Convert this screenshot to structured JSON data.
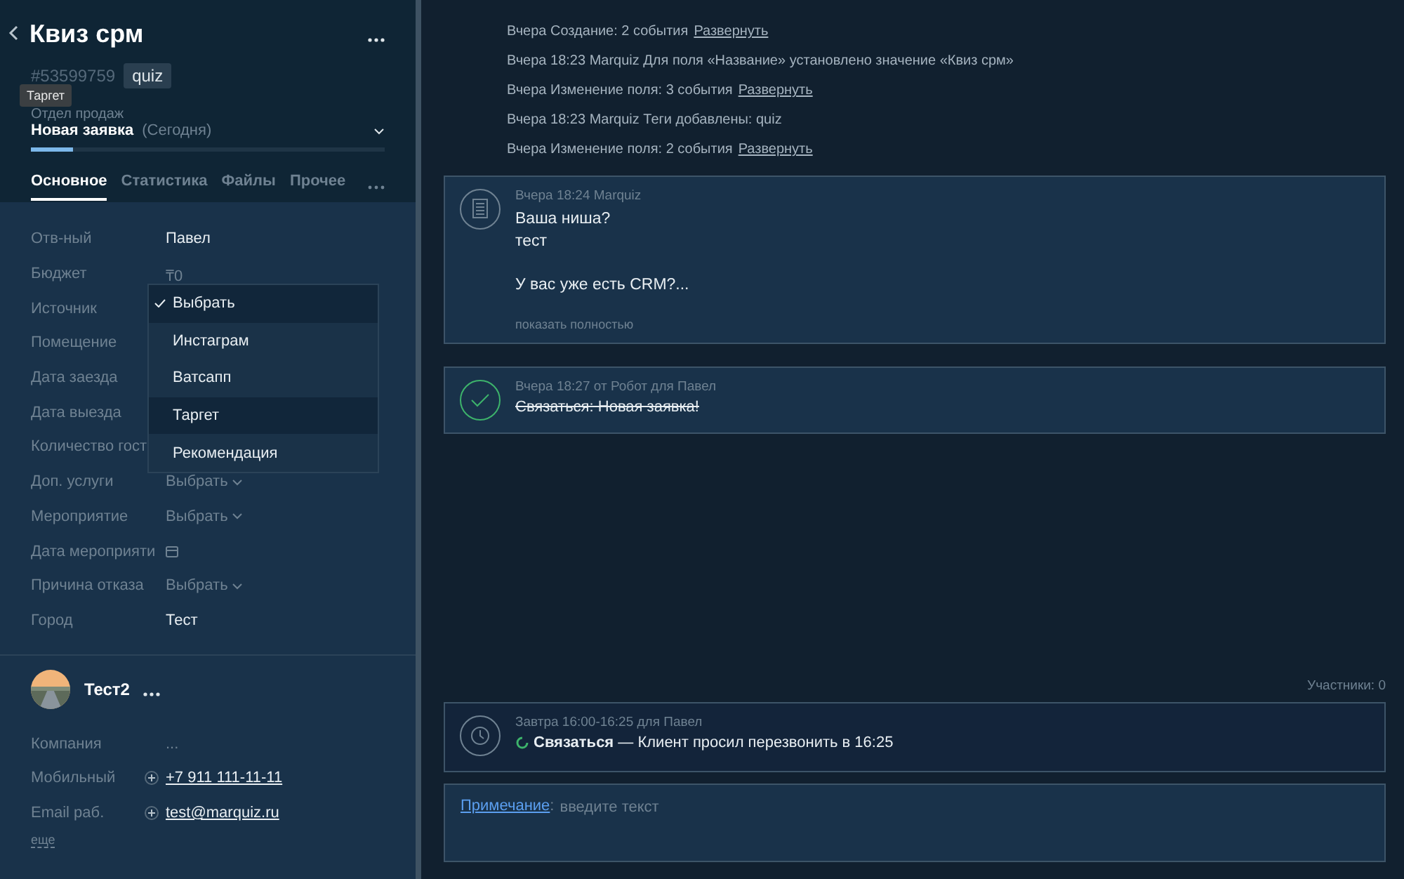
{
  "lead": {
    "title": "Квиз срм",
    "id": "#53599759",
    "tag": "quiz",
    "tooltip": "Таргет",
    "pipeline": "Отдел продаж",
    "status": "Новая заявка",
    "status_date": "(Сегодня)",
    "level": 0.12
  },
  "tabs": [
    {
      "label": "Основное",
      "selected": true
    },
    {
      "label": "Статистика",
      "selected": false
    },
    {
      "label": "Файлы",
      "selected": false
    },
    {
      "label": "Прочее",
      "selected": false
    }
  ],
  "fields": [
    {
      "label": "Отв-ный",
      "kind": "text",
      "value": "Павел"
    },
    {
      "label": "Бюджет",
      "kind": "muted",
      "value": "₸0"
    },
    {
      "label": "Источник",
      "kind": "empty"
    },
    {
      "label": "Помещение",
      "kind": "empty"
    },
    {
      "label": "Дата заезда",
      "kind": "empty"
    },
    {
      "label": "Дата выезда",
      "kind": "empty"
    },
    {
      "label": "Количество гост",
      "kind": "empty"
    },
    {
      "label": "Доп. услуги",
      "kind": "select",
      "value": "Выбрать"
    },
    {
      "label": "Мероприятие",
      "kind": "select",
      "value": "Выбрать"
    },
    {
      "label": "Дата мероприяти",
      "kind": "date"
    },
    {
      "label": "Причина отказа",
      "kind": "select",
      "value": "Выбрать"
    },
    {
      "label": "Город",
      "kind": "text",
      "value": "Тест"
    }
  ],
  "dropdown": [
    {
      "label": "Выбрать",
      "checked": true,
      "highlighted": true
    },
    {
      "label": "Инстаграм",
      "checked": false,
      "highlighted": false
    },
    {
      "label": "Ватсапп",
      "checked": false,
      "highlighted": false
    },
    {
      "label": "Таргет",
      "checked": false,
      "highlighted": true
    },
    {
      "label": "Рекомендация",
      "checked": false,
      "highlighted": false
    }
  ],
  "contact": {
    "name": "Тест2",
    "fields": [
      {
        "label": "Компания",
        "kind": "muted",
        "value": "..."
      },
      {
        "label": "Мобильный",
        "kind": "link",
        "value": "+7 911 111-11-11"
      },
      {
        "label": "Email раб.",
        "kind": "link",
        "value": "test@marquiz.ru"
      }
    ],
    "more": "еще"
  },
  "events": [
    {
      "text": "Вчера Создание: 2 события",
      "link": "Развернуть"
    },
    {
      "text": "Вчера 18:23 Marquiz Для поля «Название» установлено значение «Квиз срм»"
    },
    {
      "text": "Вчера Изменение поля: 3 события",
      "link": "Развернуть"
    },
    {
      "text": "Вчера 18:23 Marquiz Теги добавлены: quiz"
    },
    {
      "text": "Вчера Изменение поля: 2 события",
      "link": "Развернуть"
    }
  ],
  "cards": [
    {
      "kind": "note",
      "meta": "Вчера 18:24 Marquiz",
      "paragraphs": [
        "Ваша ниша?\nтест",
        "У вас уже есть CRM?..."
      ],
      "more": "показать полностью"
    },
    {
      "kind": "done",
      "meta": "Вчера 18:27  от Робот для Павел",
      "text": "Связаться: Новая заявка!"
    }
  ],
  "participants": "Участники: 0",
  "task": {
    "meta": "Завтра 16:00-16:25 для Павел",
    "text": "**Связаться** — Клиент просил перезвонить в 16:25"
  },
  "note_input": {
    "link": "Примечание",
    "suffix": ":",
    "placeholder": "введите текст"
  }
}
